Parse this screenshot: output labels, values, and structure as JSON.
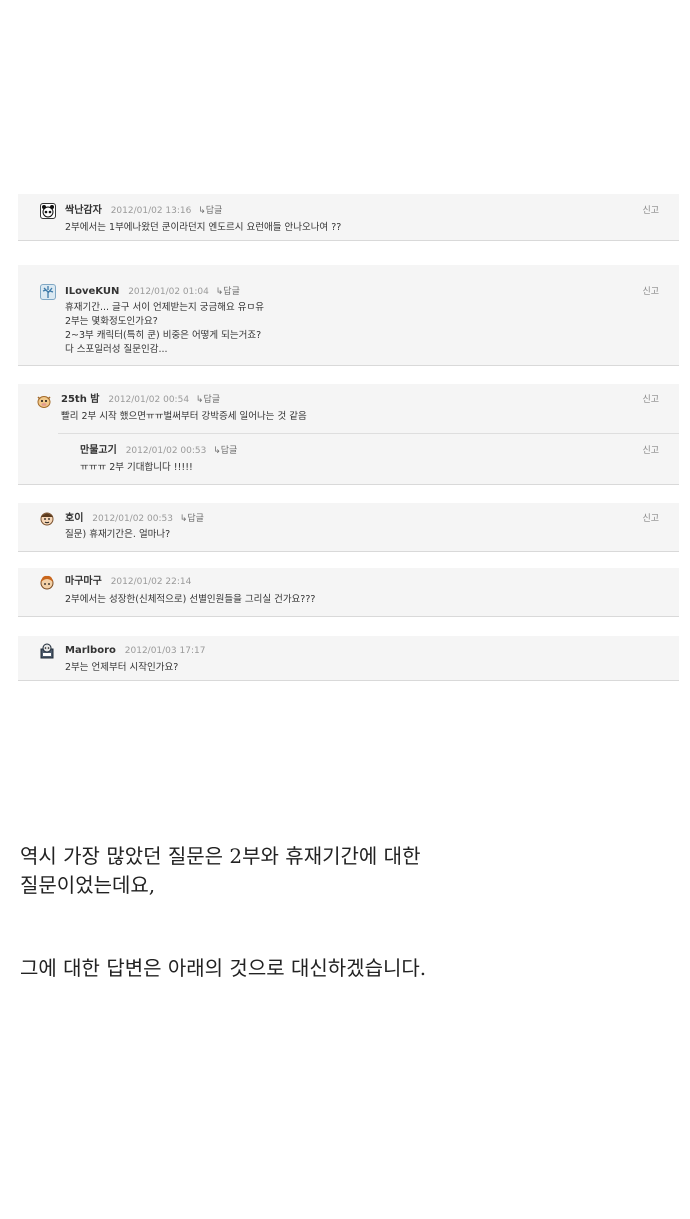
{
  "comments": [
    {
      "author": "싹난감자",
      "date": "2012/01/02 13:16",
      "reply_label": "↳답글",
      "report_label": "신고",
      "avatar_icon": "panda-icon",
      "text": "2부에서는 1부에나왔던 쿤이라던지 엔도르시 요런애들 안나오나여 ??"
    },
    {
      "author": "ILoveKUN",
      "date": "2012/01/02 01:04",
      "reply_label": "↳답글",
      "report_label": "신고",
      "avatar_icon": "tree-icon",
      "text": "휴재기간... 글구 서이 언제받는지 궁금해요 유ㅁ유\n2부는 몇화정도인가요?\n2~3부 캐릭터(특히 쿤) 비중은 어떻게 되는거죠?\n다 스포일러성 질문인감..."
    },
    {
      "author": "25th 밤",
      "date": "2012/01/02 00:54",
      "reply_label": "↳답글",
      "report_label": "신고",
      "avatar_icon": "cow-icon",
      "text": "빨리 2부 시작 했으면ㅠㅠ벌써부터 강박증세 일어나는 것 같음"
    },
    {
      "author": "만물고기",
      "date": "2012/01/02 00:53",
      "reply_label": "↳답글",
      "report_label": "신고",
      "avatar_icon": "",
      "text": "ㅠㅠㅠ 2부 기대합니다 !!!!!"
    },
    {
      "author": "호이",
      "date": "2012/01/02 00:53",
      "reply_label": "↳답글",
      "report_label": "신고",
      "avatar_icon": "face-icon",
      "text": "질문) 휴재기간은. 얼마나?"
    },
    {
      "author": "마구마구",
      "date": "2012/01/02 22:14",
      "reply_label": "",
      "report_label": "",
      "avatar_icon": "kid-icon",
      "text": "2부에서는 성장한(신체적으로) 선별인원들을 그리실 건가요???"
    },
    {
      "author": "Marlboro",
      "date": "2012/01/03 17:17",
      "reply_label": "",
      "report_label": "",
      "avatar_icon": "character-icon",
      "text": "2부는 언제부터 시작인가요?"
    }
  ],
  "article": {
    "paragraph1": "역시 가장 많았던 질문은 2부와 휴재기간에 대한\n질문이었는데요,",
    "paragraph2": "그에 대한 답변은 아래의 것으로 대신하겠습니다."
  }
}
